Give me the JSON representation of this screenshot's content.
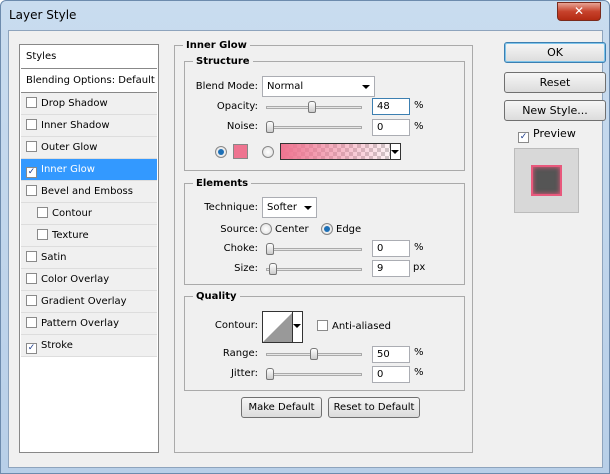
{
  "window": {
    "title": "Layer Style",
    "close": "✕"
  },
  "sidebar": {
    "items": [
      {
        "label": "Styles",
        "type": "header"
      },
      {
        "label": "Blending Options: Default",
        "type": "header"
      },
      {
        "label": "Drop Shadow",
        "checked": false
      },
      {
        "label": "Inner Shadow",
        "checked": false
      },
      {
        "label": "Outer Glow",
        "checked": false
      },
      {
        "label": "Inner Glow",
        "checked": true,
        "selected": true
      },
      {
        "label": "Bevel and Emboss",
        "checked": false
      },
      {
        "label": "Contour",
        "checked": false,
        "indent": true
      },
      {
        "label": "Texture",
        "checked": false,
        "indent": true
      },
      {
        "label": "Satin",
        "checked": false
      },
      {
        "label": "Color Overlay",
        "checked": false
      },
      {
        "label": "Gradient Overlay",
        "checked": false
      },
      {
        "label": "Pattern Overlay",
        "checked": false
      },
      {
        "label": "Stroke",
        "checked": true
      }
    ]
  },
  "panel": {
    "title": "Inner Glow",
    "structure": {
      "title": "Structure",
      "blend_mode_label": "Blend Mode:",
      "blend_mode": "Normal",
      "opacity_label": "Opacity:",
      "opacity": "48",
      "opacity_pct": 48,
      "noise_label": "Noise:",
      "noise": "0",
      "noise_pct": 0,
      "unit": "%",
      "glow_color": "#ee7490"
    },
    "elements": {
      "title": "Elements",
      "technique_label": "Technique:",
      "technique": "Softer",
      "source_label": "Source:",
      "source_center": "Center",
      "source_edge": "Edge",
      "choke_label": "Choke:",
      "choke": "0",
      "choke_pct": 0,
      "size_label": "Size:",
      "size": "9",
      "size_pct": 3.6,
      "size_unit": "px",
      "unit": "%"
    },
    "quality": {
      "title": "Quality",
      "contour_label": "Contour:",
      "anti_aliased": "Anti-aliased",
      "range_label": "Range:",
      "range": "50",
      "range_pct": 50,
      "jitter_label": "Jitter:",
      "jitter": "0",
      "jitter_pct": 0,
      "unit": "%"
    },
    "make_default": "Make Default",
    "reset_default": "Reset to Default"
  },
  "right": {
    "ok": "OK",
    "reset": "Reset",
    "new_style": "New Style...",
    "preview": "Preview"
  }
}
